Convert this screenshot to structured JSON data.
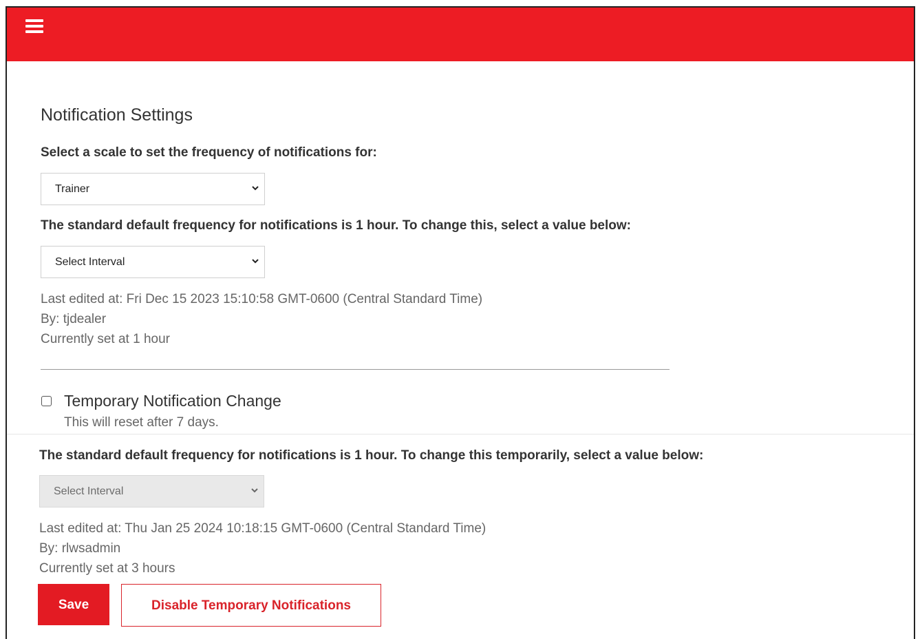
{
  "header": {
    "menu_icon": "hamburger-menu-icon",
    "bar_color": "#ed1c24"
  },
  "settings": {
    "title": "Notification Settings",
    "scale_prompt": "Select a scale to set the frequency of notifications for:",
    "scale_select": {
      "value": "Trainer"
    },
    "default_prompt": "The standard default frequency for notifications is 1 hour. To change this, select a value below:",
    "interval_select": {
      "value": "Select Interval"
    },
    "last_edited": "Last edited at: Fri Dec 15 2023 15:10:58 GMT-0600 (Central Standard Time)",
    "edited_by": "By: tjdealer",
    "current": "Currently set at 1 hour"
  },
  "temporary": {
    "checkbox_label": "Temporary Notification Change",
    "checkbox_checked": false,
    "reset_note": "This will reset after 7 days.",
    "prompt": "The standard default frequency for notifications is 1 hour. To change this temporarily, select a value below:",
    "interval_select": {
      "value": "Select Interval",
      "disabled": true
    },
    "last_edited": "Last edited at: Thu Jan 25 2024 10:18:15 GMT-0600 (Central Standard Time)",
    "edited_by": "By: rlwsadmin",
    "current": "Currently set at 3 hours"
  },
  "actions": {
    "save_label": "Save",
    "disable_label": "Disable Temporary Notifications",
    "accent_color": "#e31b23"
  }
}
